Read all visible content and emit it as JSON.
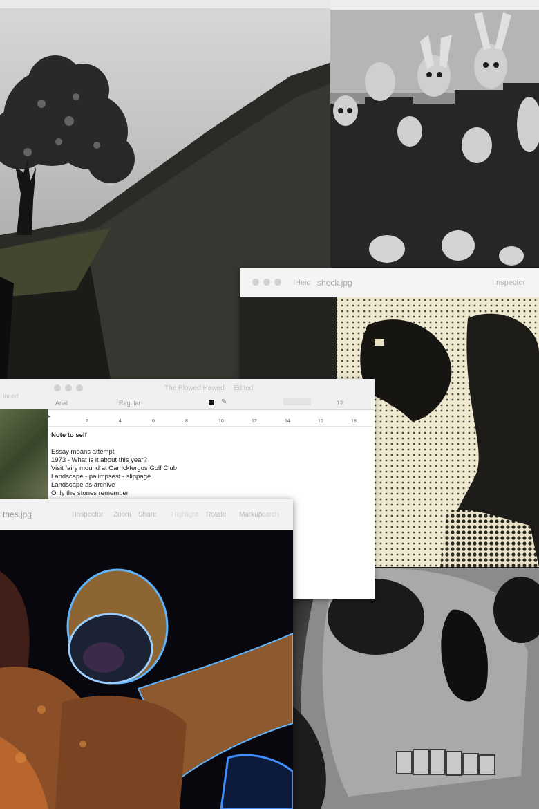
{
  "sheck_window": {
    "title": "sheck.jpg",
    "left_label": "Heic",
    "right_label": "Inspector"
  },
  "document_window": {
    "title": "The Plowed Hawed",
    "title_suffix": "Edited",
    "font_name": "Arial",
    "font_style": "Regular",
    "font_size": "12",
    "left_strip_label": "Insert",
    "ruler_marks": [
      "2",
      "4",
      "6",
      "8",
      "10",
      "12",
      "14",
      "16",
      "18"
    ],
    "note_heading": "Note to self",
    "note_lines": [
      "Essay means attempt",
      "1973 - What is it about this year?",
      "Visit fairy mound at Carrickfergus Golf Club",
      "Landscape - palimpsest - slippage",
      "Landscape as archive",
      "Only the stones remember"
    ]
  },
  "thes_window": {
    "title": "thes.jpg",
    "buttons": {
      "inspector": "Inspector",
      "zoom": "Zoom",
      "share": "Share",
      "highlight": "Highlight",
      "rotate": "Rotate",
      "markup": "Markup",
      "search": "Search"
    }
  },
  "colors": {
    "window_chrome": "#f4f4f4",
    "chrome_text": "#b8b8b8",
    "document_text": "#222222",
    "desktop": "#1a1a1a"
  },
  "icons": [
    "close-dot-icon",
    "minimize-dot-icon",
    "zoom-dot-icon",
    "sidebar-icon",
    "text-color-icon",
    "pen-icon",
    "chevron-right-icon"
  ]
}
